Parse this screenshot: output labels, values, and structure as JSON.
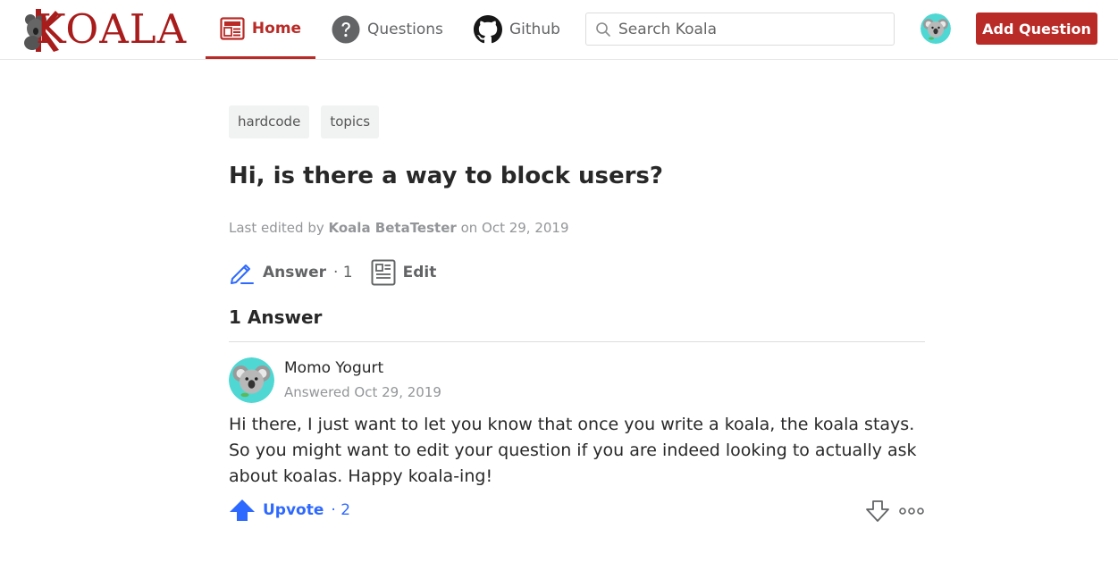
{
  "header": {
    "logo_text": "KOALA",
    "nav": {
      "home": "Home",
      "questions": "Questions",
      "github": "Github"
    },
    "search_placeholder": "Search Koala",
    "add_question": "Add Question"
  },
  "question": {
    "tags": [
      "hardcode",
      "topics"
    ],
    "title": "Hi, is there a way to block users?",
    "edited_prefix": "Last edited by",
    "editor": "Koala BetaTester",
    "edited_on": "on Oct 29, 2019",
    "answer_label": "Answer",
    "answer_count": "· 1",
    "edit_label": "Edit"
  },
  "answers": {
    "heading": "1 Answer",
    "items": [
      {
        "author": "Momo Yogurt",
        "answered": "Answered Oct 29, 2019",
        "body": "Hi there, I just want to let you know that once you write a koala, the koala stays. So you might want to edit your question if you are indeed looking to actually ask about koalas. Happy koala-ing!",
        "upvote_label": "Upvote",
        "upvote_count": "· 2"
      }
    ]
  },
  "colors": {
    "brand": "#b92b27",
    "upvote": "#2e69ff",
    "answer_icon": "#2e69ff"
  },
  "icons": [
    "koala-logo-icon",
    "home-feed-icon",
    "question-circle-icon",
    "github-icon",
    "search-icon",
    "koala-avatar-icon",
    "pencil-icon",
    "document-icon",
    "upvote-arrow-icon",
    "downvote-arrow-icon",
    "more-dots-icon"
  ]
}
